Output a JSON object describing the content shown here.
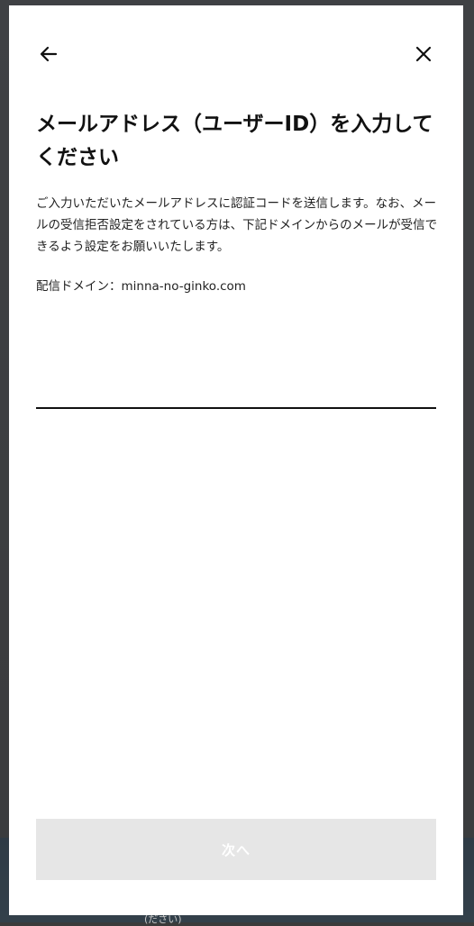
{
  "header": {
    "back_icon": "arrow-left-icon",
    "close_icon": "close-icon"
  },
  "title": "メールアドレス（ユーザーID）を入力してください",
  "description": "ご入力いただいたメールアドレスに認証コードを送信します。なお、メールの受信拒否設定をされている方は、下記ドメインからのメールが受信できるよう設定をお願いいたします。",
  "domain_text": "配信ドメイン：minna-no-ginko.com",
  "email_input": {
    "value": "",
    "placeholder": ""
  },
  "next_button": {
    "label": "次へ"
  },
  "backdrop_text": "(ださい)",
  "colors": {
    "text": "#111111",
    "disabled_button_bg": "#e6e6e6",
    "disabled_button_text": "#ffffff"
  }
}
